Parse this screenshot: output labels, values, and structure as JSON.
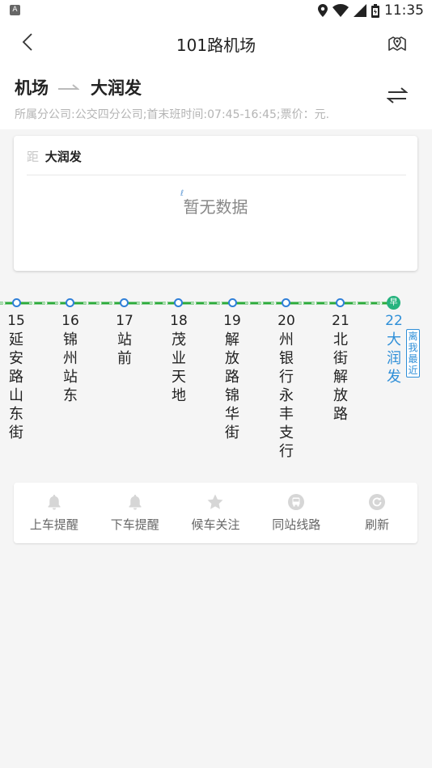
{
  "status_bar": {
    "app_badge": "A",
    "time": "11:35",
    "icons": [
      "location-icon",
      "wifi-icon",
      "signal-icon",
      "battery-icon"
    ]
  },
  "header": {
    "title": "101路机场",
    "back_icon": "chevron-left-icon",
    "map_icon": "map-pin-icon"
  },
  "route": {
    "origin": "机场",
    "destination": "大润发",
    "info": "所属分公司:公交四分公司;首末班时间:07:45-16:45;票价：元.",
    "swap_icon": "swap-direction-icon"
  },
  "distance_card": {
    "prefix": "距",
    "stop": "大润发",
    "empty_text": "暂无数据",
    "empty_mark": "ℓ"
  },
  "stops": [
    {
      "num": "15",
      "name": "延安路山东街"
    },
    {
      "num": "16",
      "name": "锦州站东"
    },
    {
      "num": "17",
      "name": "站前"
    },
    {
      "num": "18",
      "name": "茂业天地"
    },
    {
      "num": "19",
      "name": "解放路锦华街"
    },
    {
      "num": "20",
      "name": "州银行永丰支行"
    },
    {
      "num": "21",
      "name": "北街解放路"
    },
    {
      "num": "22",
      "name": "大润发"
    }
  ],
  "terminal_badge": "早",
  "nearest_label": "离我最近",
  "actions": [
    {
      "label": "上车提醒",
      "icon": "bell-icon"
    },
    {
      "label": "下车提醒",
      "icon": "bell-icon"
    },
    {
      "label": "候车关注",
      "icon": "star-icon"
    },
    {
      "label": "同站线路",
      "icon": "bus-stop-icon"
    },
    {
      "label": "刷新",
      "icon": "refresh-icon"
    }
  ],
  "colors": {
    "line_green": "#2bab3a",
    "stop_blue": "#2f7fd8",
    "current_blue": "#2f8fd8",
    "terminal_green": "#26b37e",
    "icon_gray": "#d6d6d6"
  }
}
